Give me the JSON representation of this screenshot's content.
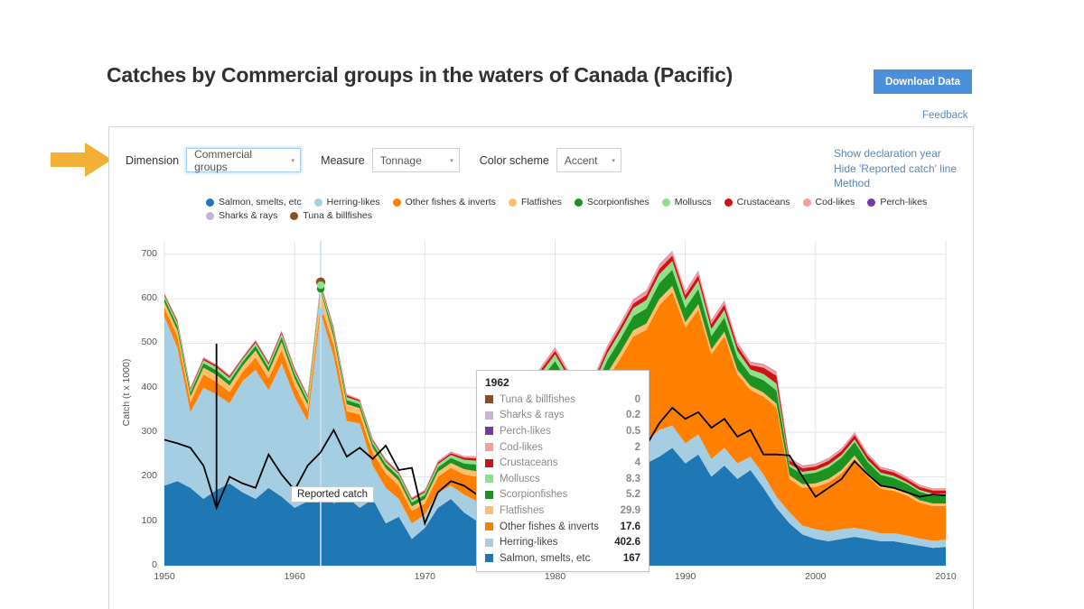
{
  "header": {
    "title": "Catches by Commercial groups in the waters of Canada (Pacific)",
    "download_label": "Download Data",
    "feedback_label": "Feedback"
  },
  "controls": {
    "dimension_label": "Dimension",
    "dimension_value": "Commercial groups",
    "measure_label": "Measure",
    "measure_value": "Tonnage",
    "color_scheme_label": "Color scheme",
    "color_scheme_value": "Accent",
    "caret": "▾"
  },
  "side_links": [
    {
      "label": "Show declaration year"
    },
    {
      "label": "Hide 'Reported catch' line"
    },
    {
      "label": "Method"
    }
  ],
  "legend": [
    {
      "label": "Salmon, smelts, etc",
      "color": "#1f78b4"
    },
    {
      "label": "Herring-likes",
      "color": "#a6cee3"
    },
    {
      "label": "Other fishes & inverts",
      "color": "#ff7f00"
    },
    {
      "label": "Flatfishes",
      "color": "#fdbf6f"
    },
    {
      "label": "Scorpionfishes",
      "color": "#1d9220"
    },
    {
      "label": "Molluscs",
      "color": "#8ee08a"
    },
    {
      "label": "Crustaceans",
      "color": "#cc1416"
    },
    {
      "label": "Cod-likes",
      "color": "#fb9a99"
    },
    {
      "label": "Perch-likes",
      "color": "#7839a8"
    },
    {
      "label": "Sharks & rays",
      "color": "#cab2d6"
    },
    {
      "label": "Tuna & billfishes",
      "color": "#8a5023"
    }
  ],
  "tooltip": {
    "year": "1962",
    "rows": [
      {
        "label": "Tuna & billfishes",
        "value": "0",
        "color": "#8a5023",
        "dim": true
      },
      {
        "label": "Sharks & rays",
        "value": "0.2",
        "color": "#cab2d6",
        "dim": true
      },
      {
        "label": "Perch-likes",
        "value": "0.5",
        "color": "#7839a8",
        "dim": true
      },
      {
        "label": "Cod-likes",
        "value": "2",
        "color": "#fb9a99",
        "dim": true
      },
      {
        "label": "Crustaceans",
        "value": "4",
        "color": "#cc1416",
        "dim": true
      },
      {
        "label": "Molluscs",
        "value": "8.3",
        "color": "#8ee08a",
        "dim": true
      },
      {
        "label": "Scorpionfishes",
        "value": "5.2",
        "color": "#1d9220",
        "dim": true
      },
      {
        "label": "Flatfishes",
        "value": "29.9",
        "color": "#fdbf6f",
        "dim": true
      },
      {
        "label": "Other fishes & inverts",
        "value": "17.6",
        "color": "#ff7f00",
        "dim": false
      },
      {
        "label": "Herring-likes",
        "value": "402.6",
        "color": "#a6cee3",
        "dim": false
      },
      {
        "label": "Salmon, smelts, etc",
        "value": "167",
        "color": "#1f78b4",
        "dim": false
      }
    ]
  },
  "reported_catch_tip": {
    "label": "Reported catch"
  },
  "chart_data": {
    "type": "area",
    "title": "Catches by Commercial groups in the waters of Canada (Pacific)",
    "xlabel": "",
    "ylabel": "Catch (t x 1000)",
    "xlim": [
      1950,
      2010
    ],
    "ylim": [
      0,
      730
    ],
    "ytick_values": [
      0,
      100,
      200,
      300,
      400,
      500,
      600,
      700
    ],
    "xtick_values": [
      1950,
      1960,
      1970,
      1980,
      1990,
      2000,
      2010
    ],
    "grid": true,
    "legend_position": "top",
    "stacked": true,
    "highlight_year": 1962,
    "x": [
      1950,
      1951,
      1952,
      1953,
      1954,
      1955,
      1956,
      1957,
      1958,
      1959,
      1960,
      1961,
      1962,
      1963,
      1964,
      1965,
      1966,
      1967,
      1968,
      1969,
      1970,
      1971,
      1972,
      1973,
      1974,
      1975,
      1976,
      1977,
      1978,
      1979,
      1980,
      1981,
      1982,
      1983,
      1984,
      1985,
      1986,
      1987,
      1988,
      1989,
      1990,
      1991,
      1992,
      1993,
      1994,
      1995,
      1996,
      1997,
      1998,
      1999,
      2000,
      2001,
      2002,
      2003,
      2004,
      2005,
      2006,
      2007,
      2008,
      2009,
      2010
    ],
    "series": [
      {
        "name": "Salmon, smelts, etc",
        "color": "#1f78b4",
        "values": [
          180,
          190,
          175,
          150,
          170,
          185,
          165,
          150,
          175,
          155,
          130,
          145,
          167,
          140,
          155,
          130,
          150,
          95,
          110,
          60,
          85,
          130,
          150,
          120,
          100,
          130,
          155,
          175,
          205,
          230,
          250,
          215,
          180,
          160,
          200,
          215,
          240,
          230,
          245,
          265,
          230,
          250,
          200,
          225,
          195,
          215,
          175,
          130,
          95,
          70,
          60,
          55,
          60,
          65,
          60,
          55,
          55,
          50,
          45,
          40,
          42
        ]
      },
      {
        "name": "Herring-likes",
        "color": "#a6cee3",
        "values": [
          380,
          300,
          170,
          250,
          215,
          180,
          250,
          290,
          220,
          300,
          250,
          180,
          402.6,
          330,
          170,
          190,
          75,
          80,
          40,
          35,
          30,
          35,
          30,
          40,
          45,
          40,
          40,
          45,
          45,
          45,
          45,
          45,
          50,
          45,
          55,
          60,
          55,
          50,
          60,
          50,
          45,
          45,
          40,
          40,
          35,
          30,
          30,
          25,
          25,
          20,
          22,
          22,
          22,
          20,
          20,
          18,
          18,
          18,
          16,
          16,
          16
        ]
      },
      {
        "name": "Other fishes & inverts",
        "color": "#ff7f00",
        "values": [
          20,
          25,
          22,
          30,
          28,
          25,
          20,
          28,
          25,
          30,
          25,
          22,
          17.6,
          25,
          22,
          20,
          28,
          32,
          30,
          28,
          25,
          35,
          40,
          45,
          55,
          65,
          70,
          85,
          95,
          110,
          125,
          115,
          130,
          150,
          165,
          190,
          220,
          250,
          280,
          300,
          260,
          280,
          235,
          250,
          200,
          150,
          175,
          200,
          75,
          85,
          95,
          110,
          125,
          155,
          120,
          100,
          95,
          90,
          80,
          78,
          76
        ]
      },
      {
        "name": "Flatfishes",
        "color": "#fdbf6f",
        "values": [
          12,
          14,
          13,
          15,
          16,
          15,
          14,
          16,
          15,
          18,
          16,
          15,
          29.9,
          18,
          16,
          14,
          12,
          12,
          11,
          10,
          10,
          11,
          11,
          12,
          12,
          12,
          12,
          13,
          13,
          13,
          14,
          12,
          12,
          13,
          13,
          14,
          14,
          14,
          14,
          14,
          12,
          13,
          11,
          11,
          10,
          9,
          9,
          9,
          8,
          8,
          8,
          8,
          8,
          8,
          7,
          7,
          7,
          6,
          6,
          6,
          6
        ]
      },
      {
        "name": "Scorpionfishes",
        "color": "#1d9220",
        "values": [
          9,
          10,
          9,
          10,
          10,
          10,
          9,
          10,
          10,
          11,
          10,
          9,
          5.2,
          10,
          9,
          9,
          9,
          9,
          9,
          9,
          9,
          10,
          11,
          13,
          15,
          17,
          18,
          20,
          22,
          24,
          26,
          24,
          25,
          27,
          28,
          30,
          32,
          34,
          36,
          36,
          32,
          34,
          30,
          32,
          28,
          25,
          28,
          30,
          20,
          22,
          24,
          26,
          28,
          30,
          26,
          24,
          22,
          20,
          19,
          18,
          18
        ]
      },
      {
        "name": "Molluscs",
        "color": "#8ee08a",
        "values": [
          6,
          7,
          6,
          7,
          7,
          7,
          6,
          7,
          7,
          8,
          7,
          7,
          8.3,
          7,
          7,
          6,
          6,
          6,
          6,
          6,
          6,
          7,
          7,
          8,
          9,
          10,
          11,
          12,
          13,
          14,
          15,
          14,
          14,
          15,
          16,
          17,
          18,
          19,
          20,
          20,
          18,
          19,
          16,
          17,
          15,
          12,
          14,
          15,
          6,
          6,
          6,
          6,
          6,
          6,
          5,
          5,
          5,
          4,
          4,
          4,
          4
        ]
      },
      {
        "name": "Crustaceans",
        "color": "#cc1416",
        "values": [
          3,
          4,
          3,
          4,
          4,
          4,
          3,
          4,
          4,
          4,
          4,
          3,
          4,
          4,
          4,
          3,
          3,
          3,
          3,
          3,
          3,
          4,
          4,
          5,
          5,
          6,
          6,
          7,
          7,
          8,
          8,
          8,
          8,
          9,
          9,
          10,
          10,
          11,
          12,
          12,
          11,
          12,
          11,
          12,
          11,
          10,
          14,
          18,
          8,
          8,
          8,
          9,
          9,
          10,
          9,
          8,
          8,
          7,
          7,
          7,
          7
        ]
      },
      {
        "name": "Cod-likes",
        "color": "#fb9a99",
        "values": [
          2,
          2,
          2,
          2,
          2,
          2,
          2,
          2,
          2,
          2,
          2,
          2,
          2,
          2,
          2,
          2,
          2,
          2,
          2,
          2,
          2,
          3,
          3,
          3,
          4,
          4,
          5,
          5,
          6,
          6,
          7,
          6,
          6,
          7,
          7,
          8,
          8,
          9,
          9,
          9,
          8,
          9,
          8,
          8,
          7,
          6,
          7,
          8,
          5,
          5,
          5,
          5,
          5,
          5,
          5,
          4,
          4,
          4,
          4,
          4,
          4
        ]
      },
      {
        "name": "Perch-likes",
        "color": "#7839a8",
        "values": [
          0.5,
          0.5,
          0.5,
          0.5,
          0.5,
          0.5,
          0.5,
          0.5,
          0.5,
          0.5,
          0.5,
          0.5,
          0.5,
          0.5,
          0.5,
          0.5,
          0.5,
          0.5,
          0.5,
          0.5,
          0.5,
          0.5,
          0.5,
          0.5,
          0.6,
          0.6,
          0.6,
          0.7,
          0.7,
          0.8,
          0.8,
          0.8,
          0.8,
          0.9,
          0.9,
          1,
          1,
          1,
          1,
          1,
          1,
          1,
          1,
          1,
          1,
          1,
          1,
          1,
          0.8,
          0.8,
          0.8,
          0.8,
          0.8,
          0.8,
          0.7,
          0.7,
          0.7,
          0.6,
          0.6,
          0.6,
          0.6
        ]
      },
      {
        "name": "Sharks & rays",
        "color": "#cab2d6",
        "values": [
          0.2,
          0.2,
          0.2,
          0.2,
          0.2,
          0.2,
          0.2,
          0.2,
          0.2,
          0.2,
          0.2,
          0.2,
          0.2,
          0.2,
          0.2,
          0.2,
          0.2,
          0.2,
          0.2,
          0.2,
          0.2,
          0.3,
          0.3,
          0.3,
          0.3,
          0.4,
          0.4,
          0.4,
          0.5,
          0.5,
          0.5,
          0.5,
          0.5,
          0.6,
          0.6,
          0.6,
          0.7,
          0.7,
          0.7,
          0.7,
          0.6,
          0.7,
          0.6,
          0.6,
          0.5,
          0.5,
          0.5,
          0.5,
          0.4,
          0.4,
          0.4,
          0.4,
          0.4,
          0.4,
          0.3,
          0.3,
          0.3,
          0.3,
          0.3,
          0.3,
          0.3
        ]
      },
      {
        "name": "Tuna & billfishes",
        "color": "#8a5023",
        "values": [
          0,
          0,
          0,
          0,
          0,
          0,
          0,
          0,
          0,
          0,
          0,
          0,
          0,
          0,
          0,
          0,
          0,
          0,
          0,
          0,
          0,
          0,
          0,
          0,
          0,
          0,
          0,
          0,
          0,
          0,
          0,
          0,
          0,
          0,
          0,
          0,
          0,
          0,
          0,
          0,
          0,
          0,
          0,
          0,
          0,
          0,
          0,
          0,
          0,
          0,
          0,
          0,
          0,
          0,
          0,
          0,
          0,
          0,
          0,
          0,
          0
        ]
      }
    ],
    "reported_catch_line": {
      "name": "Reported catch",
      "color": "#000000",
      "values": [
        283,
        275,
        265,
        225,
        130,
        200,
        185,
        175,
        250,
        205,
        170,
        225,
        255,
        305,
        245,
        265,
        240,
        270,
        215,
        220,
        95,
        165,
        190,
        180,
        160,
        200,
        215,
        235,
        250,
        235,
        230,
        215,
        210,
        230,
        250,
        245,
        250,
        270,
        320,
        355,
        330,
        345,
        310,
        330,
        290,
        305,
        250,
        250,
        248,
        200,
        155,
        175,
        195,
        235,
        205,
        180,
        175,
        165,
        155,
        160,
        158
      ]
    }
  }
}
